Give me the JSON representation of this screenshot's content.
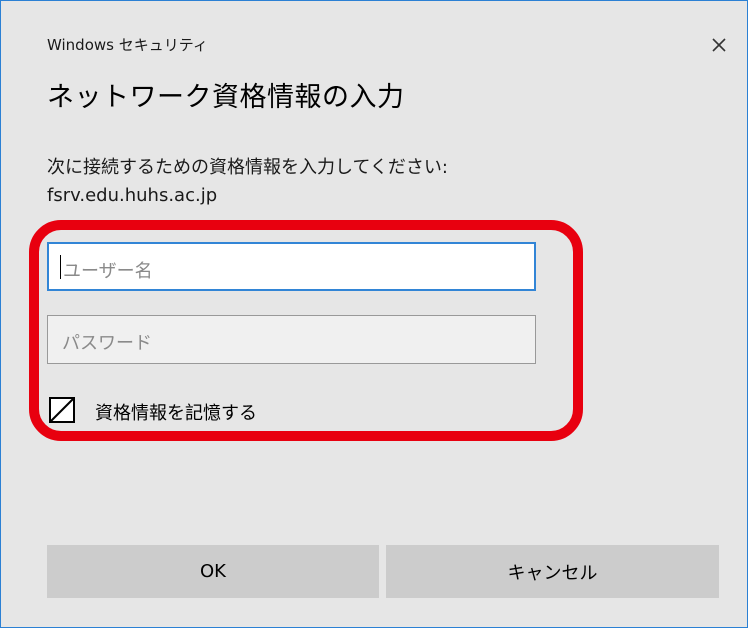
{
  "window": {
    "title": "Windows セキュリティ"
  },
  "dialog": {
    "heading": "ネットワーク資格情報の入力",
    "prompt": "次に接続するための資格情報を入力してください:",
    "server": "fsrv.edu.huhs.ac.jp"
  },
  "form": {
    "username": {
      "value": "",
      "placeholder": "ユーザー名",
      "focused": true
    },
    "password": {
      "value": "",
      "placeholder": "パスワード"
    },
    "remember": {
      "label": "資格情報を記憶する",
      "checked": false
    }
  },
  "buttons": {
    "ok_label": "OK",
    "cancel_label": "キャンセル"
  },
  "icons": {
    "close": "close-icon",
    "checkbox": "checkbox-icon"
  },
  "colors": {
    "dialog_background": "#e6e6e6",
    "accent_border": "#3285d6",
    "highlight": "#e8000f",
    "button_background": "#cccccc"
  }
}
